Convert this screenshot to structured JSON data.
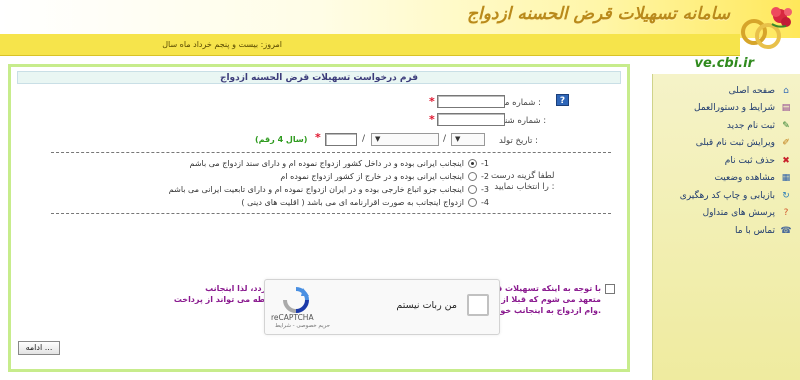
{
  "banner": {
    "title": "سامانه تسهیلات قرض الحسنه ازدواج",
    "date": "امروز: بیست و پنجم خرداد ماه سال",
    "domain": "ve.cbi.ir"
  },
  "form": {
    "header": "فرم درخواست تسهیلات قرض الحسنه ازدواج",
    "national_id_label": "شماره ملی :",
    "birth_cert_label": "شماره شناسنامه :",
    "birth_date_label": "تاریخ تولد :",
    "year_hint": "(سال 4 رقم)",
    "day_select": "▼",
    "month_select": "▼",
    "required_mark": "*",
    "help_icon": "?",
    "slash": "/",
    "choose_label_1": "لطفا گزینه درست",
    "choose_label_2": "را انتخاب نمایید :",
    "options": [
      {
        "num": "-1",
        "text": "اینجانب ایرانی بوده و در داخل کشور ازدواج نموده ام و دارای سند ازدواج می باشم",
        "checked": true
      },
      {
        "num": "-2",
        "text": "اینجانب ایرانی بوده و در خارج از کشور ازدواج نموده ام",
        "checked": false
      },
      {
        "num": "-3",
        "text": "اینجانب جزو اتباع خارجی بوده و در ایران ازدواج نموده ام و دارای تابعیت ایرانی می باشم",
        "checked": false
      },
      {
        "num": "-4",
        "text": "ازدواج اینجانب به صورت اقرارنامه ای می باشد ( اقلیت های دینی )",
        "checked": false
      }
    ],
    "notice_line_1": "با توجه به اینکه تسهیلات قرض الحسنه ازدواج فقط یک مرتبه به متقاضیان اعطا می گردد، لذا اینجانب",
    "notice_line_2": "متعهد می شوم که قبلا از این تسهیلات استفاده نکرده ام و در غیر اینصورت بانک مربوطه می تواند از پرداخت",
    "notice_line_3": "وام ازدواج به اینجانب خودداری نماید.",
    "continue_label": "ادامه ..."
  },
  "recaptcha": {
    "label": "من ربات نیستم",
    "brand": "reCAPTCHA",
    "terms": "حریم خصوصی - شرایط"
  },
  "sidebar": {
    "items": [
      {
        "label": "صفحه اصلی",
        "icon": "home-icon",
        "glyph": "⌂",
        "color": "#3a6fb5"
      },
      {
        "label": "شرایط و دستورالعمل",
        "icon": "book-icon",
        "glyph": "▤",
        "color": "#8a3b8f"
      },
      {
        "label": "ثبت نام جدید",
        "icon": "new-registration-icon",
        "glyph": "✎",
        "color": "#2f7f2f"
      },
      {
        "label": "ویرایش ثبت نام قبلی",
        "icon": "edit-icon",
        "glyph": "✐",
        "color": "#c07a12"
      },
      {
        "label": "حذف ثبت نام",
        "icon": "delete-icon",
        "glyph": "✖",
        "color": "#c8202b"
      },
      {
        "label": "مشاهده وضعیت",
        "icon": "status-icon",
        "glyph": "▦",
        "color": "#2d5fa8"
      },
      {
        "label": "بازیابی و چاپ کد رهگیری",
        "icon": "recover-icon",
        "glyph": "↻",
        "color": "#2d7fb8"
      },
      {
        "label": "پرسش های متداول",
        "icon": "faq-icon",
        "glyph": "?",
        "color": "#d0542a"
      },
      {
        "label": "تماس با ما",
        "icon": "contact-icon",
        "glyph": "☎",
        "color": "#4a6a9a"
      }
    ]
  },
  "colors": {
    "accent_yellow": "#f6e44b",
    "panel_border": "#c7ec8c",
    "notice": "#8a1a8f",
    "hint_green": "#2d9a1d"
  }
}
